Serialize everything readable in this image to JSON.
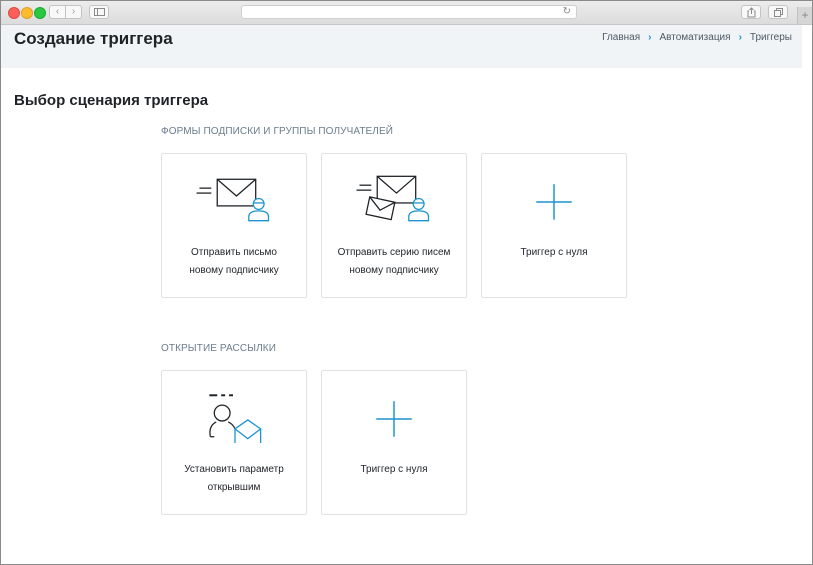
{
  "page": {
    "title": "Создание триггера",
    "breadcrumb": [
      "Главная",
      "Автоматизация",
      "Триггеры"
    ]
  },
  "main": {
    "section_title": "Выбор сценария триггера",
    "groups": [
      {
        "label": "ФОРМЫ ПОДПИСКИ И ГРУППЫ ПОЛУЧАТЕЛЕЙ",
        "cards": [
          {
            "line1": "Отправить письмо",
            "line2": "новому подписчику",
            "icon": "envelope-subscriber-icon"
          },
          {
            "line1": "Отправить серию писем",
            "line2": "новому подписчику",
            "icon": "envelopes-subscriber-icon"
          },
          {
            "line1": "Триггер с нуля",
            "icon": "plus-icon"
          }
        ]
      },
      {
        "label": "ОТКРЫТИЕ РАССЫЛКИ",
        "cards": [
          {
            "line1": "Установить параметр",
            "line2": "открывшим",
            "icon": "person-open-envelope-icon"
          },
          {
            "line1": "Триггер с нуля",
            "icon": "plus-icon"
          }
        ]
      }
    ]
  },
  "colors": {
    "accent": "#1c93d1",
    "header_bg": "#f1f4f6",
    "card_border": "#dfe3e6"
  }
}
